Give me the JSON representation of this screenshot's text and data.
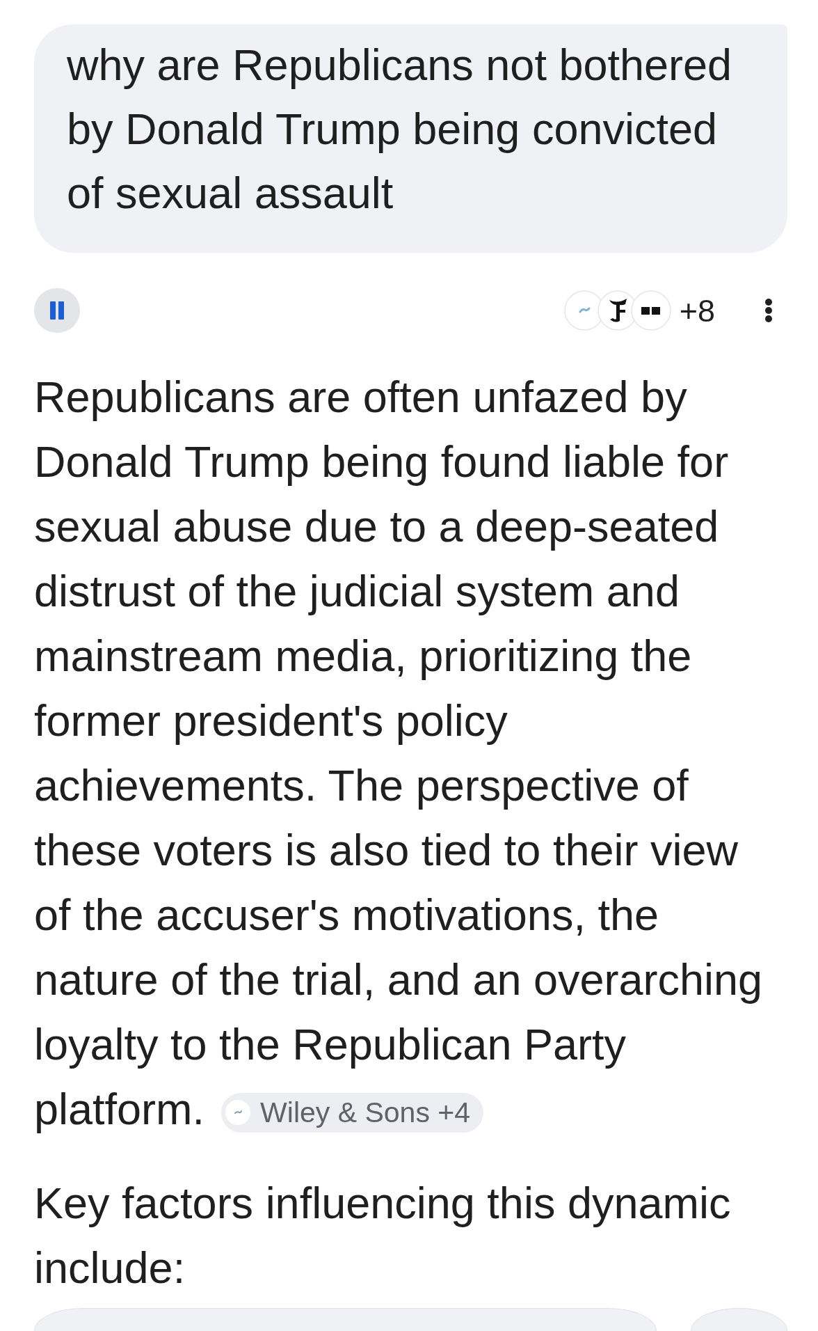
{
  "query": {
    "text": "why are Republicans not bothered by Donald Trump being convicted of sexual assault"
  },
  "toolbar": {
    "read_aloud": {
      "playing": true
    },
    "sources": {
      "more_count": "+8"
    }
  },
  "answer": {
    "paragraph": "Republicans are often unfazed by Donald Trump being found liable for sexual abuse due to a deep-seated distrust of the judicial system and mainstream media, prioritizing the former president's policy achievements. The perspective of these voters is also tied to their view of the accuser's motivations, the nature of the trial, and an overarching loyalty to the Republican Party platform.",
    "citation": {
      "label": "Wiley & Sons +4"
    },
    "subheading": "Key factors influencing this dynamic include:"
  }
}
